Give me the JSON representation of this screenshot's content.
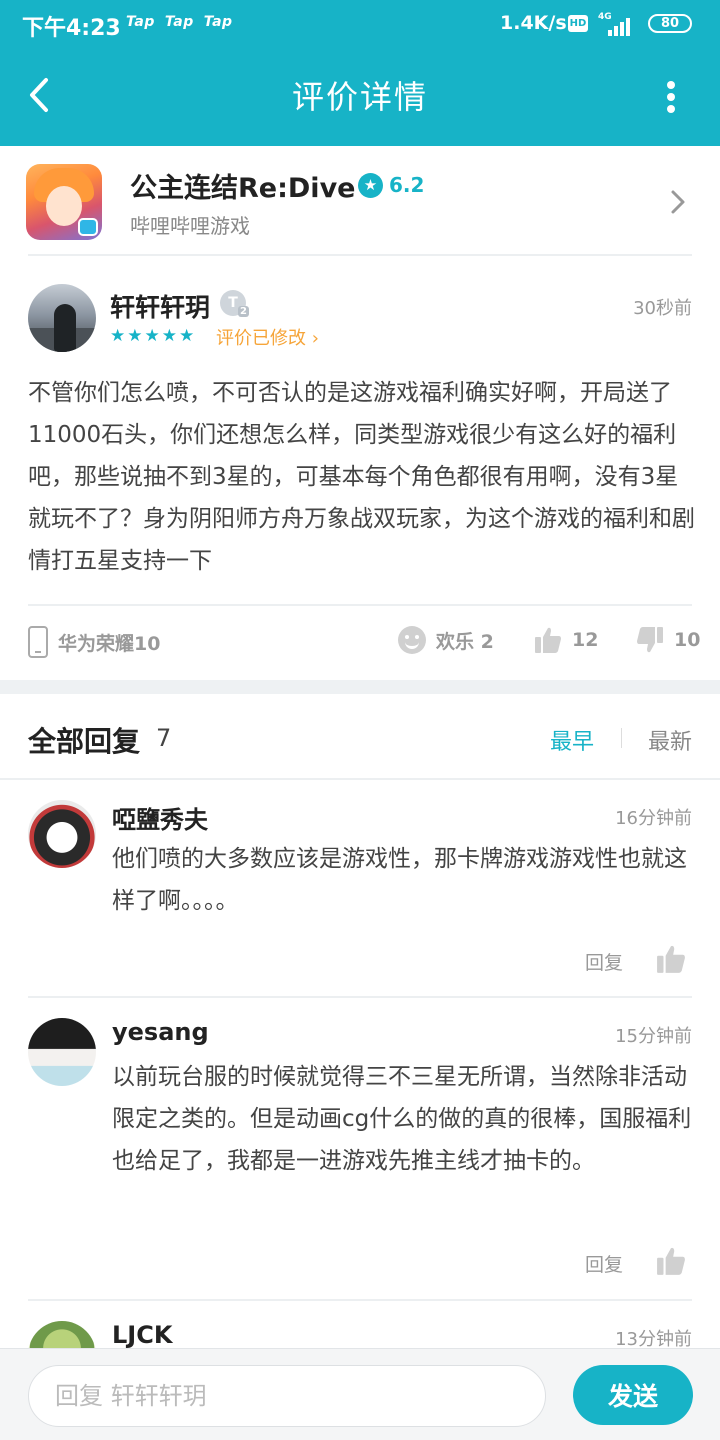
{
  "status_bar": {
    "time": "下午4:23",
    "tap_labels": [
      "Tap",
      "Tap",
      "Tap"
    ],
    "net_speed": "1.4K/s",
    "hd_label": "HD",
    "network": "4G",
    "battery": "80"
  },
  "nav": {
    "title": "评价详情",
    "back_icon": "chevron-left-icon",
    "more_icon": "more-vertical-icon"
  },
  "game": {
    "name": "公主连结Re:Dive",
    "score": "6.2",
    "publisher": "哔哩哔哩游戏"
  },
  "review": {
    "author": "轩轩轩玥",
    "level_badge": "T",
    "level_sub": "2",
    "time": "30秒前",
    "stars": "★★★★★",
    "rating": 5,
    "modified_label": "评价已修改",
    "text": "不管你们怎么喷，不可否认的是这游戏福利确实好啊，开局送了11000石头，你们还想怎么样，同类型游戏很少有这么好的福利吧，那些说抽不到3星的，可基本每个角色都很有用啊，没有3星就玩不了？身为阴阳师方舟万象战双玩家，为这个游戏的福利和剧情打五星支持一下",
    "device": "华为荣耀10",
    "funny_label": "欢乐 2",
    "like_count": "12",
    "dislike_count": "10"
  },
  "replies_header": {
    "title": "全部回复",
    "count": "7",
    "sort_earliest": "最早",
    "sort_latest": "最新"
  },
  "replies": [
    {
      "author": "啞鹽秀夫",
      "time": "16分钟前",
      "text": "他们喷的大多数应该是游戏性，那卡牌游戏游戏性也就这样了啊。。。。",
      "reply_label": "回复"
    },
    {
      "author": "yesang",
      "time": "15分钟前",
      "text": "以前玩台服的时候就觉得三不三星无所谓，当然除非活动限定之类的。但是动画cg什么的做的真的很棒，国服福利也给足了，我都是一进游戏先推主线才抽卡的。",
      "reply_label": "回复"
    },
    {
      "author": "LJCK",
      "time": "13分钟前"
    }
  ],
  "bottom_bar": {
    "input_placeholder": "回复 轩轩轩玥",
    "send_label": "发送"
  },
  "colors": {
    "accent": "#17b3c7",
    "modified": "#f6a53a"
  }
}
